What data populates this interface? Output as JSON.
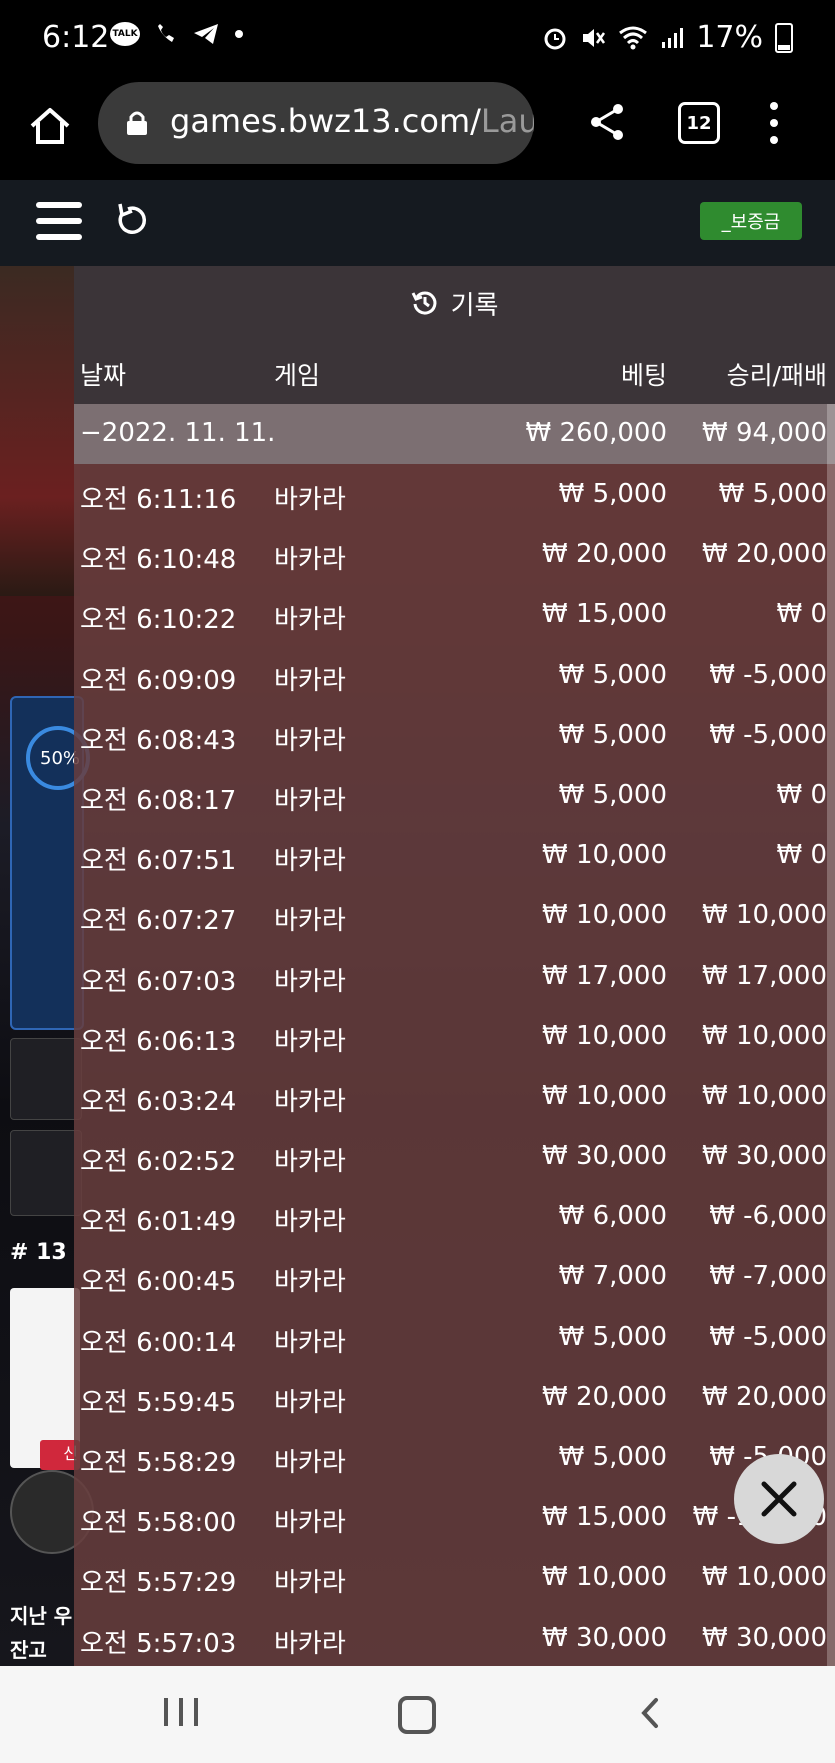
{
  "status_bar": {
    "time": "6:12",
    "talk_badge": "TALK",
    "battery": "17%"
  },
  "browser": {
    "url_main": "games.bwz13.com/",
    "url_rest": "Laui",
    "tab_count": "12"
  },
  "header": {
    "deposit_label": "_보증금"
  },
  "background": {
    "panel_percent": "50%",
    "table_number": "# 13",
    "new_badge": "신",
    "last_win_label": "지난 우",
    "balance_label": "잔고"
  },
  "history": {
    "title": "기록",
    "columns": {
      "date": "날짜",
      "game": "게임",
      "bet": "베팅",
      "win_loss": "승리/패배"
    },
    "summary": {
      "date": "−2022. 11. 11.",
      "bet": "₩ 260,000",
      "win_loss": "₩ 94,000"
    },
    "rows": [
      {
        "time": "오전 6:11:16",
        "game": "바카라",
        "bet": "₩ 5,000",
        "result": "₩ 5,000"
      },
      {
        "time": "오전 6:10:48",
        "game": "바카라",
        "bet": "₩ 20,000",
        "result": "₩ 20,000"
      },
      {
        "time": "오전 6:10:22",
        "game": "바카라",
        "bet": "₩ 15,000",
        "result": "₩ 0"
      },
      {
        "time": "오전 6:09:09",
        "game": "바카라",
        "bet": "₩ 5,000",
        "result": "₩ -5,000"
      },
      {
        "time": "오전 6:08:43",
        "game": "바카라",
        "bet": "₩ 5,000",
        "result": "₩ -5,000"
      },
      {
        "time": "오전 6:08:17",
        "game": "바카라",
        "bet": "₩ 5,000",
        "result": "₩ 0"
      },
      {
        "time": "오전 6:07:51",
        "game": "바카라",
        "bet": "₩ 10,000",
        "result": "₩ 0"
      },
      {
        "time": "오전 6:07:27",
        "game": "바카라",
        "bet": "₩ 10,000",
        "result": "₩ 10,000"
      },
      {
        "time": "오전 6:07:03",
        "game": "바카라",
        "bet": "₩ 17,000",
        "result": "₩ 17,000"
      },
      {
        "time": "오전 6:06:13",
        "game": "바카라",
        "bet": "₩ 10,000",
        "result": "₩ 10,000"
      },
      {
        "time": "오전 6:03:24",
        "game": "바카라",
        "bet": "₩ 10,000",
        "result": "₩ 10,000"
      },
      {
        "time": "오전 6:02:52",
        "game": "바카라",
        "bet": "₩ 30,000",
        "result": "₩ 30,000"
      },
      {
        "time": "오전 6:01:49",
        "game": "바카라",
        "bet": "₩ 6,000",
        "result": "₩ -6,000"
      },
      {
        "time": "오전 6:00:45",
        "game": "바카라",
        "bet": "₩ 7,000",
        "result": "₩ -7,000"
      },
      {
        "time": "오전 6:00:14",
        "game": "바카라",
        "bet": "₩ 5,000",
        "result": "₩ -5,000"
      },
      {
        "time": "오전 5:59:45",
        "game": "바카라",
        "bet": "₩ 20,000",
        "result": "₩ 20,000"
      },
      {
        "time": "오전 5:58:29",
        "game": "바카라",
        "bet": "₩ 5,000",
        "result": "₩ -5,000"
      },
      {
        "time": "오전 5:58:00",
        "game": "바카라",
        "bet": "₩ 15,000",
        "result": "₩ -15,000"
      },
      {
        "time": "오전 5:57:29",
        "game": "바카라",
        "bet": "₩ 10,000",
        "result": "₩ 10,000"
      },
      {
        "time": "오전 5:57:03",
        "game": "바카라",
        "bet": "₩ 30,000",
        "result": "₩ 30,000"
      }
    ]
  },
  "colors": {
    "deposit_green": "#2f8b2f",
    "overlay": "#683e3e",
    "header_dark": "#151a20"
  },
  "icons": [
    "home-icon",
    "lock-icon",
    "share-icon",
    "tabs-icon",
    "menu-icon",
    "hamburger-icon",
    "refresh-icon",
    "history-icon",
    "close-icon",
    "nav-recent-icon",
    "nav-home-icon",
    "nav-back-icon"
  ]
}
